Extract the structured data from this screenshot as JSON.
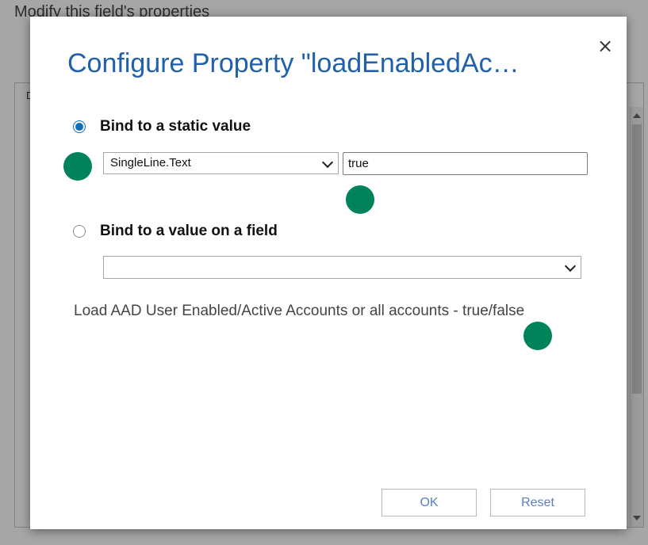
{
  "background": {
    "page_title": "Modify this field's properties",
    "panel_tab": "D"
  },
  "dialog": {
    "title": "Configure Property \"loadEnabledAc…",
    "close_symbol": "×",
    "static_option": {
      "label": "Bind to a static value",
      "selected": true,
      "type_select_value": "SingleLine.Text",
      "value_input": "true"
    },
    "field_option": {
      "label": "Bind to a value on a field",
      "selected": false,
      "field_select_value": ""
    },
    "description": "Load AAD User Enabled/Active Accounts or all accounts - true/false",
    "buttons": {
      "ok": "OK",
      "reset": "Reset"
    }
  },
  "colors": {
    "title": "#2160ab",
    "radio_checked": "#0f6cbd",
    "marker": "#00825a",
    "button_text": "#5a7fc0"
  }
}
